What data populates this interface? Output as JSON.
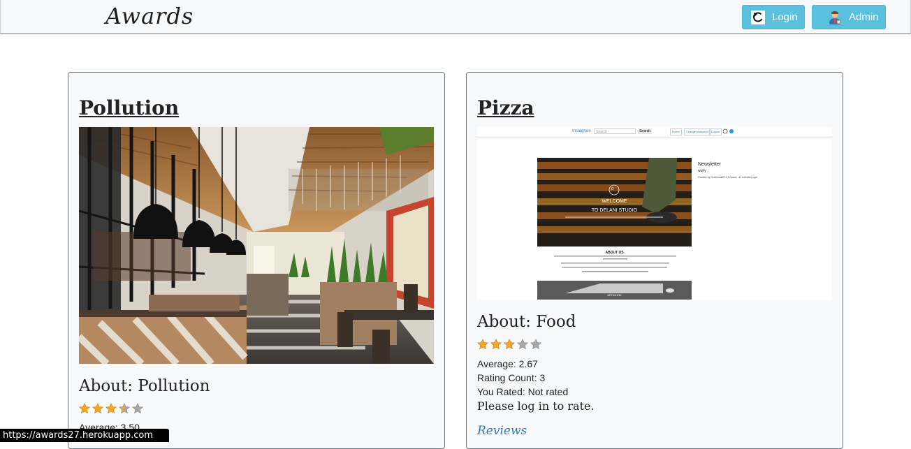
{
  "nav": {
    "brand": "Awards",
    "login_label": "Login",
    "admin_label": "Admin",
    "button_color": "#5bc0de"
  },
  "projects": [
    {
      "title": "Pollution",
      "image_icon": "restaurant-interior-photo",
      "about": "About: Pollution",
      "rating_stars": 3.5,
      "average": "Average: 3.50"
    },
    {
      "title": "Pizza",
      "image_icon": "website-screenshot",
      "about": "About: Food",
      "rating_stars": 2.67,
      "average": "Average: 2.67",
      "rating_count": "Rating Count: 3",
      "you_rated": "You Rated: Not rated",
      "login_prompt": "Please log in to rate.",
      "reviews_link": "Reviews",
      "screenshot": {
        "nav_brand": "Instagram",
        "search_placeholder": "Search",
        "search_button": "Search",
        "nav_links": [
          "Home",
          "Change password",
          "Logout"
        ],
        "post_title": "Newsletter",
        "post_caption": "worly",
        "post_meta": "Posted by Sullesha82 21 hours, 41 minutes ago",
        "hero_logo": "D",
        "hero_title": "WELCOME",
        "hero_subtitle": "TO DELANI STUDIO",
        "section_title": "ABOUT US",
        "second_label": "ARTWORK"
      }
    }
  ],
  "status_url": "https://awards27.herokuapp.com"
}
